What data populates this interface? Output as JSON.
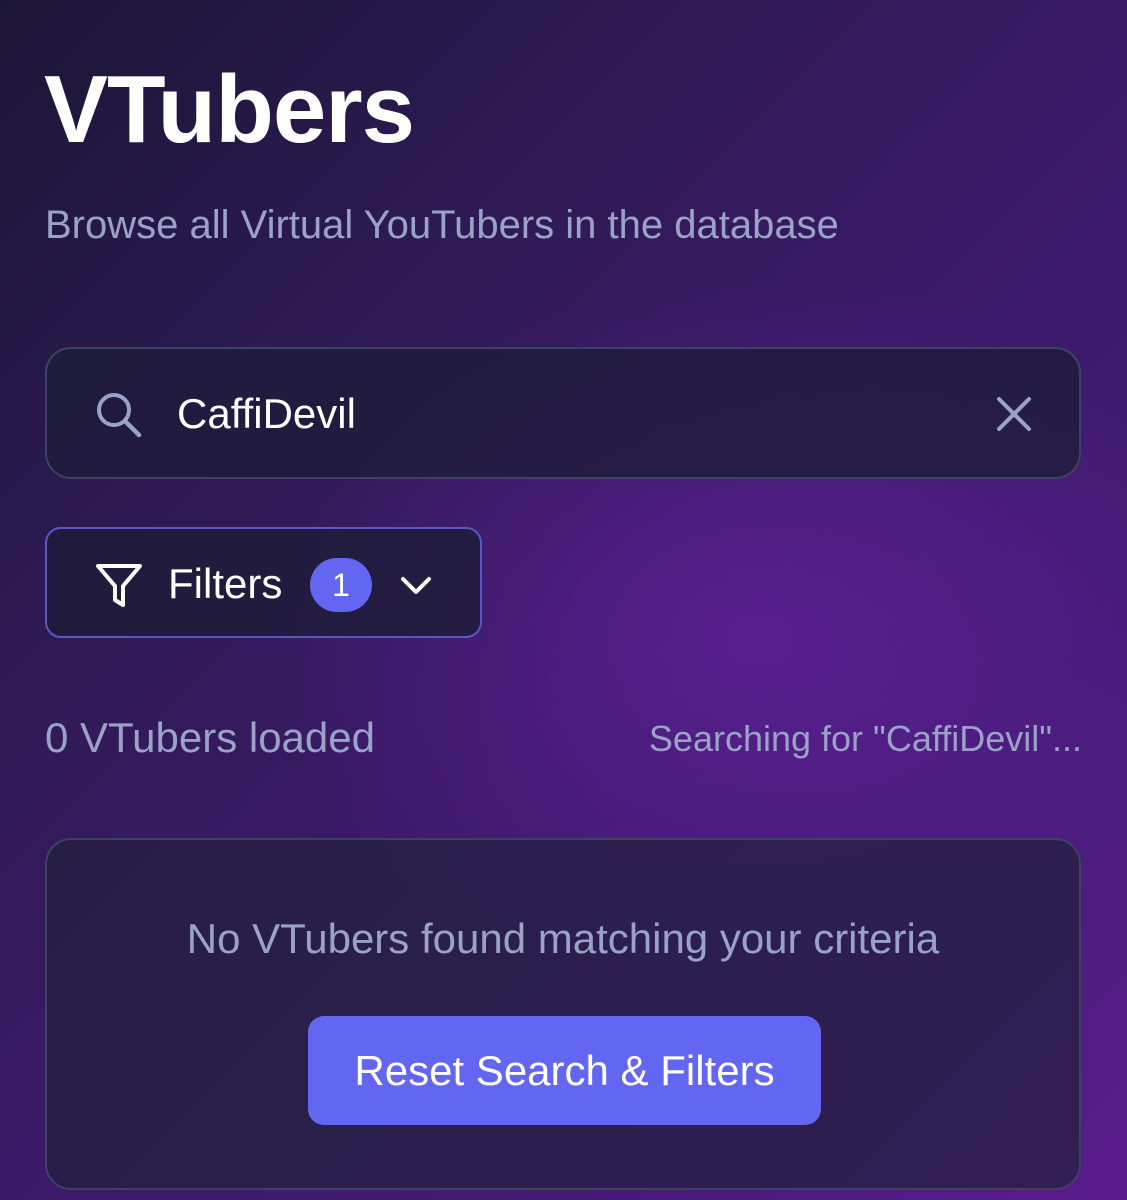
{
  "header": {
    "title": "VTubers",
    "subtitle": "Browse all Virtual YouTubers in the database"
  },
  "search": {
    "value": "CaffiDevil",
    "icon": "search-icon",
    "clear_icon": "close-icon"
  },
  "filters": {
    "label": "Filters",
    "active_count": "1",
    "icon": "filter-icon",
    "chevron_icon": "chevron-down-icon"
  },
  "status": {
    "count_text": "0 VTubers loaded",
    "searching_text": "Searching for \"CaffiDevil\"..."
  },
  "empty_state": {
    "message": "No VTubers found matching your criteria",
    "reset_label": "Reset Search & Filters"
  },
  "colors": {
    "accent": "#6366f1",
    "muted_text": "#9aa2c8",
    "border": "#3b4360"
  }
}
